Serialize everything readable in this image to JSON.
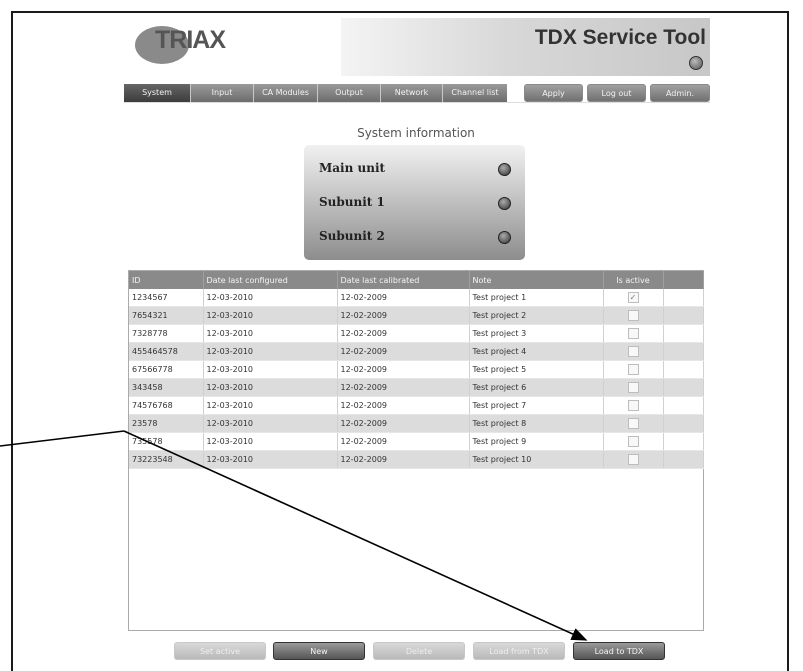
{
  "header": {
    "logo_text": "TRIAX",
    "app_title": "TDX Service Tool"
  },
  "nav": {
    "tabs": [
      {
        "label": "System",
        "active": true
      },
      {
        "label": "Input"
      },
      {
        "label": "CA Modules"
      },
      {
        "label": "Output"
      },
      {
        "label": "Network"
      },
      {
        "label": "Channel list"
      }
    ],
    "apply_label": "Apply",
    "logout_label": "Log out",
    "admin_label": "Admin."
  },
  "system_info": {
    "title": "System information",
    "units": [
      {
        "label": "Main unit"
      },
      {
        "label": "Subunit 1"
      },
      {
        "label": "Subunit 2"
      }
    ]
  },
  "table": {
    "columns": [
      "ID",
      "Date last configured",
      "Date last calibrated",
      "Note",
      "Is active"
    ],
    "rows": [
      {
        "id": "1234567",
        "configured": "12-03-2010",
        "calibrated": "12-02-2009",
        "note": "Test project 1",
        "active": true
      },
      {
        "id": "7654321",
        "configured": "12-03-2010",
        "calibrated": "12-02-2009",
        "note": "Test project 2",
        "active": false
      },
      {
        "id": "7328778",
        "configured": "12-03-2010",
        "calibrated": "12-02-2009",
        "note": "Test project 3",
        "active": false
      },
      {
        "id": "455464578",
        "configured": "12-03-2010",
        "calibrated": "12-02-2009",
        "note": "Test project 4",
        "active": false
      },
      {
        "id": "67566778",
        "configured": "12-03-2010",
        "calibrated": "12-02-2009",
        "note": "Test project 5",
        "active": false
      },
      {
        "id": "343458",
        "configured": "12-03-2010",
        "calibrated": "12-02-2009",
        "note": "Test project 6",
        "active": false
      },
      {
        "id": "74576768",
        "configured": "12-03-2010",
        "calibrated": "12-02-2009",
        "note": "Test project 7",
        "active": false
      },
      {
        "id": "23578",
        "configured": "12-03-2010",
        "calibrated": "12-02-2009",
        "note": "Test project 8",
        "active": false
      },
      {
        "id": "735578",
        "configured": "12-03-2010",
        "calibrated": "12-02-2009",
        "note": "Test project 9",
        "active": false
      },
      {
        "id": "73223548",
        "configured": "12-03-2010",
        "calibrated": "12-02-2009",
        "note": "Test project 10",
        "active": false
      }
    ]
  },
  "actions": {
    "set_active": "Set active",
    "new": "New",
    "delete": "Delete",
    "load_from_tdx": "Load from TDX",
    "load_to_tdx": "Load to TDX"
  },
  "icons": {
    "checkmark": "✓"
  }
}
